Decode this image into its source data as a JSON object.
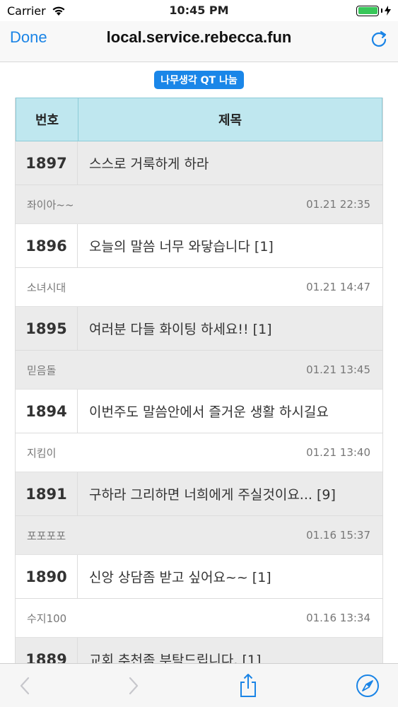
{
  "status": {
    "carrier": "Carrier",
    "time": "10:45 PM"
  },
  "nav": {
    "done_label": "Done",
    "title": "local.service.rebecca.fun"
  },
  "board": {
    "category": "나무생각 QT 나눔",
    "columns": {
      "number": "번호",
      "title": "제목"
    },
    "posts": [
      {
        "number": "1897",
        "title": "스스로 거룩하게 하라",
        "author": "좌이아~~",
        "date": "01.21 22:35"
      },
      {
        "number": "1896",
        "title": "오늘의 말씀 너무 와닿습니다 [1]",
        "author": "소녀시대",
        "date": "01.21 14:47"
      },
      {
        "number": "1895",
        "title": "여러분 다들 화이팅 하세요!! [1]",
        "author": "믿음돌",
        "date": "01.21 13:45"
      },
      {
        "number": "1894",
        "title": "이번주도 말씀안에서 즐거운 생활 하시길요",
        "author": "지킴이",
        "date": "01.21 13:40"
      },
      {
        "number": "1891",
        "title": "구하라 그리하면 너희에게 주실것이요... [9]",
        "author": "포포포포",
        "date": "01.16 15:37"
      },
      {
        "number": "1890",
        "title": "신앙 상담좀 받고 싶어요~~ [1]",
        "author": "수지100",
        "date": "01.16 13:34"
      },
      {
        "number": "1889",
        "title": "교회 추천좀 부탁드립니다. [1]",
        "author": "",
        "date": ""
      }
    ]
  },
  "colors": {
    "accent": "#1a84e6",
    "header_bg": "#bfe7ef",
    "row_alt": "#ebebeb",
    "battery": "#38c759"
  },
  "icons": {
    "wifi": "wifi-icon",
    "reload": "reload-icon",
    "back": "chevron-left-icon",
    "forward": "chevron-right-icon",
    "share": "share-icon",
    "safari": "compass-icon"
  }
}
